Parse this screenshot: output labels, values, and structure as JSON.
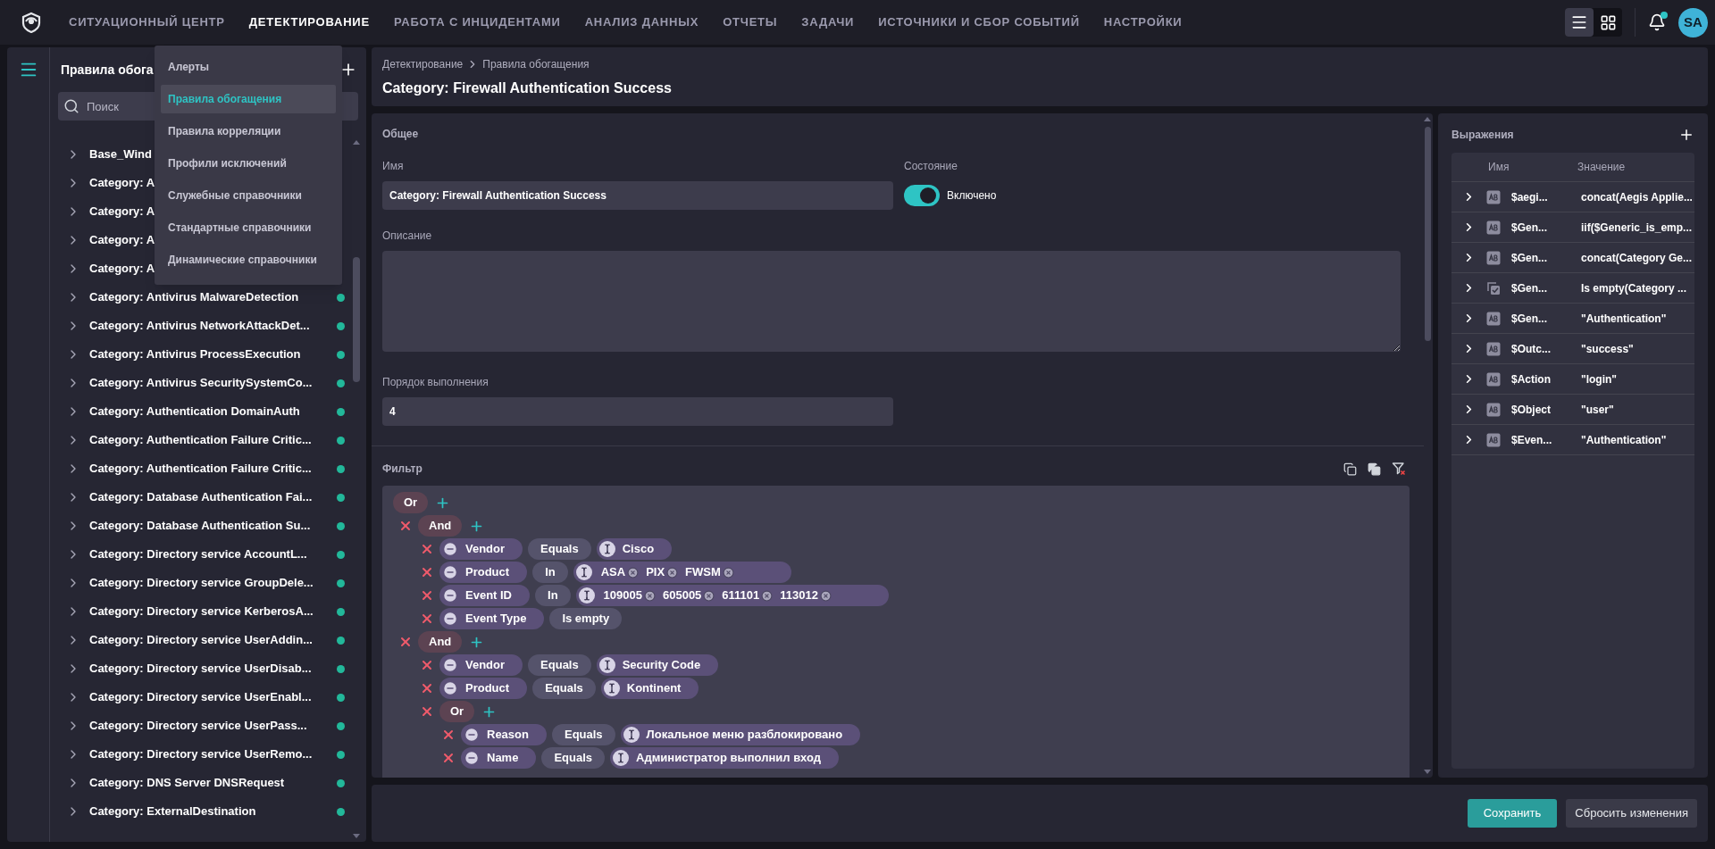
{
  "nav": {
    "items": [
      {
        "label": "СИТУАЦИОННЫЙ ЦЕНТР",
        "selected": false
      },
      {
        "label": "ДЕТЕКТИРОВАНИЕ",
        "selected": true
      },
      {
        "label": "РАБОТА С ИНЦИДЕНТАМИ",
        "selected": false
      },
      {
        "label": "АНАЛИЗ ДАННЫХ",
        "selected": false
      },
      {
        "label": "ОТЧЕТЫ",
        "selected": false
      },
      {
        "label": "ЗАДАЧИ",
        "selected": false
      },
      {
        "label": "ИСТОЧНИКИ И СБОР СОБЫТИЙ",
        "selected": false
      },
      {
        "label": "НАСТРОЙКИ",
        "selected": false
      }
    ]
  },
  "view_toggle": [
    {
      "kind": "list",
      "selected": true
    },
    {
      "kind": "grid",
      "selected": false
    }
  ],
  "notifications": {
    "unread": true
  },
  "user": {
    "initials": "SA"
  },
  "menu": {
    "items": [
      {
        "label": "Алерты",
        "selected": false
      },
      {
        "label": "Правила обогащения",
        "selected": true
      },
      {
        "label": "Правила корреляции",
        "selected": false
      },
      {
        "label": "Профили исключений",
        "selected": false
      },
      {
        "label": "Служебные справочники",
        "selected": false
      },
      {
        "label": "Стандартные справочники",
        "selected": false
      },
      {
        "label": "Динамические справочники",
        "selected": false
      }
    ]
  },
  "sidebar": {
    "title": "Правила обога",
    "search": {
      "placeholder": "Поиск"
    },
    "items": [
      {
        "label": "Base_Wind"
      },
      {
        "label": "Category: A"
      },
      {
        "label": "Category: A"
      },
      {
        "label": "Category: A"
      },
      {
        "label": "Category: A"
      },
      {
        "label": "Category: Antivirus MalwareDetection",
        "active": true
      },
      {
        "label": "Category: Antivirus NetworkAttackDet...",
        "active": true
      },
      {
        "label": "Category: Antivirus ProcessExecution",
        "active": true
      },
      {
        "label": "Category: Antivirus SecuritySystemCo...",
        "active": true
      },
      {
        "label": "Category: Authentication DomainAuth",
        "active": true
      },
      {
        "label": "Category: Authentication Failure Critic...",
        "active": true
      },
      {
        "label": "Category: Authentication Failure Critic...",
        "active": true
      },
      {
        "label": "Category: Database Authentication Fai...",
        "active": true
      },
      {
        "label": "Category: Database Authentication Su...",
        "active": true
      },
      {
        "label": "Category: Directory service AccountL...",
        "active": true
      },
      {
        "label": "Category: Directory service GroupDele...",
        "active": true
      },
      {
        "label": "Category: Directory service KerberosA...",
        "active": true
      },
      {
        "label": "Category: Directory service UserAddin...",
        "active": true
      },
      {
        "label": "Category: Directory service UserDisab...",
        "active": true
      },
      {
        "label": "Category: Directory service UserEnabl...",
        "active": true
      },
      {
        "label": "Category: Directory service UserPass...",
        "active": true
      },
      {
        "label": "Category: Directory service UserRemo...",
        "active": true
      },
      {
        "label": "Category: DNS Server DNSRequest",
        "active": true
      },
      {
        "label": "Category: ExternalDestination",
        "active": true
      }
    ]
  },
  "header": {
    "breadcrumb": [
      "Детектирование",
      "Правила обогащения"
    ],
    "title": "Category: Firewall Authentication Success"
  },
  "form": {
    "section": "Общее",
    "name_label": "Имя",
    "name_value": "Category: Firewall Authentication Success",
    "state_label": "Состояние",
    "state_on": true,
    "state_text": "Включено",
    "description_label": "Описание",
    "order_label": "Порядок выполнения",
    "order_value": "4"
  },
  "filter": {
    "title": "Фильтр",
    "root": {
      "kind": "group",
      "op": "Or",
      "children": [
        {
          "kind": "group",
          "op": "And",
          "children": [
            {
              "kind": "condition",
              "field": "Vendor",
              "operator": "Equals",
              "value": "Cisco"
            },
            {
              "kind": "condition",
              "field": "Product",
              "operator": "In",
              "values": [
                "ASA",
                "PIX",
                "FWSM"
              ]
            },
            {
              "kind": "condition",
              "field": "Event ID",
              "operator": "In",
              "values": [
                "109005",
                "605005",
                "611101",
                "113012"
              ]
            },
            {
              "kind": "condition",
              "field": "Event Type",
              "operator": "Is empty"
            }
          ]
        },
        {
          "kind": "group",
          "op": "And",
          "children": [
            {
              "kind": "condition",
              "field": "Vendor",
              "operator": "Equals",
              "value": "Security Code"
            },
            {
              "kind": "condition",
              "field": "Product",
              "operator": "Equals",
              "value": "Kontinent"
            },
            {
              "kind": "group",
              "op": "Or",
              "children": [
                {
                  "kind": "condition",
                  "field": "Reason",
                  "operator": "Equals",
                  "value": "Локальное меню разблокировано"
                },
                {
                  "kind": "condition",
                  "field": "Name",
                  "operator": "Equals",
                  "value": "Администратор выполнил вход"
                }
              ]
            }
          ]
        }
      ]
    }
  },
  "expressions": {
    "title": "Выражения",
    "columns": [
      "Имя",
      "Значение"
    ],
    "rows": [
      {
        "kind": "text",
        "name": "$aegi...",
        "value": "concat(Aegis Applie..."
      },
      {
        "kind": "text",
        "name": "$Gen...",
        "value": "iif($Generic_is_emp..."
      },
      {
        "kind": "text",
        "name": "$Gen...",
        "value": "concat(Category Ge..."
      },
      {
        "kind": "bool",
        "name": "$Gen...",
        "value": "Is empty(Category ..."
      },
      {
        "kind": "text",
        "name": "$Gen...",
        "value": "\"Authentication\""
      },
      {
        "kind": "text",
        "name": "$Outc...",
        "value": "\"success\""
      },
      {
        "kind": "text",
        "name": "$Action",
        "value": "\"login\""
      },
      {
        "kind": "text",
        "name": "$Object",
        "value": "\"user\""
      },
      {
        "kind": "text",
        "name": "$Even...",
        "value": "\"Authentication\""
      }
    ]
  },
  "footer": {
    "buttons": [
      "Сохранить",
      "Сбросить изменения"
    ]
  }
}
